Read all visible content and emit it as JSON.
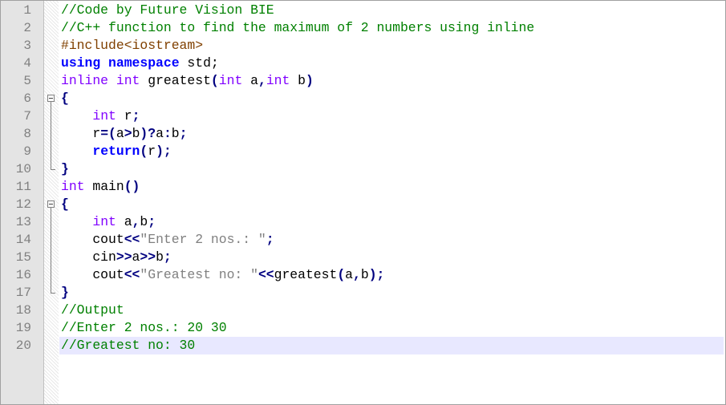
{
  "editor": {
    "current_line": 20,
    "lines": [
      {
        "n": "1",
        "tokens": [
          {
            "t": "//Code by Future Vision BIE",
            "c": "cm"
          }
        ]
      },
      {
        "n": "2",
        "tokens": [
          {
            "t": "//C++ function to find the maximum of 2 numbers using inline",
            "c": "cm"
          }
        ]
      },
      {
        "n": "3",
        "tokens": [
          {
            "t": "#include<iostream>",
            "c": "pp"
          }
        ]
      },
      {
        "n": "4",
        "tokens": [
          {
            "t": "using",
            "c": "kw"
          },
          {
            "t": " ",
            "c": "df"
          },
          {
            "t": "namespace",
            "c": "kw"
          },
          {
            "t": " std;",
            "c": "df"
          }
        ]
      },
      {
        "n": "5",
        "tokens": [
          {
            "t": "inline",
            "c": "ty"
          },
          {
            "t": " ",
            "c": "df"
          },
          {
            "t": "int",
            "c": "ty"
          },
          {
            "t": " greatest",
            "c": "df"
          },
          {
            "t": "(",
            "c": "op"
          },
          {
            "t": "int",
            "c": "ty"
          },
          {
            "t": " a",
            "c": "df"
          },
          {
            "t": ",",
            "c": "op"
          },
          {
            "t": "int",
            "c": "ty"
          },
          {
            "t": " b",
            "c": "df"
          },
          {
            "t": ")",
            "c": "op"
          }
        ],
        "fold": "none"
      },
      {
        "n": "6",
        "tokens": [
          {
            "t": "{",
            "c": "op"
          }
        ],
        "fold": "start"
      },
      {
        "n": "7",
        "tokens": [
          {
            "t": "    ",
            "c": "df"
          },
          {
            "t": "int",
            "c": "ty"
          },
          {
            "t": " r",
            "c": "df"
          },
          {
            "t": ";",
            "c": "op"
          }
        ],
        "fold": "mid"
      },
      {
        "n": "8",
        "tokens": [
          {
            "t": "    r",
            "c": "df"
          },
          {
            "t": "=(",
            "c": "op"
          },
          {
            "t": "a",
            "c": "df"
          },
          {
            "t": ">",
            "c": "op"
          },
          {
            "t": "b",
            "c": "df"
          },
          {
            "t": ")?",
            "c": "op"
          },
          {
            "t": "a",
            "c": "df"
          },
          {
            "t": ":",
            "c": "op"
          },
          {
            "t": "b",
            "c": "df"
          },
          {
            "t": ";",
            "c": "op"
          }
        ],
        "fold": "mid"
      },
      {
        "n": "9",
        "tokens": [
          {
            "t": "    ",
            "c": "df"
          },
          {
            "t": "return",
            "c": "kw"
          },
          {
            "t": "(",
            "c": "op"
          },
          {
            "t": "r",
            "c": "df"
          },
          {
            "t": ");",
            "c": "op"
          }
        ],
        "fold": "mid"
      },
      {
        "n": "10",
        "tokens": [
          {
            "t": "}",
            "c": "op"
          }
        ],
        "fold": "end"
      },
      {
        "n": "11",
        "tokens": [
          {
            "t": "int",
            "c": "ty"
          },
          {
            "t": " main",
            "c": "df"
          },
          {
            "t": "()",
            "c": "op"
          }
        ]
      },
      {
        "n": "12",
        "tokens": [
          {
            "t": "{",
            "c": "op"
          }
        ],
        "fold": "start"
      },
      {
        "n": "13",
        "tokens": [
          {
            "t": "    ",
            "c": "df"
          },
          {
            "t": "int",
            "c": "ty"
          },
          {
            "t": " a",
            "c": "df"
          },
          {
            "t": ",",
            "c": "op"
          },
          {
            "t": "b",
            "c": "df"
          },
          {
            "t": ";",
            "c": "op"
          }
        ],
        "fold": "mid"
      },
      {
        "n": "14",
        "tokens": [
          {
            "t": "    cout",
            "c": "df"
          },
          {
            "t": "<<",
            "c": "op"
          },
          {
            "t": "\"Enter 2 nos.: \"",
            "c": "st"
          },
          {
            "t": ";",
            "c": "op"
          }
        ],
        "fold": "mid"
      },
      {
        "n": "15",
        "tokens": [
          {
            "t": "    cin",
            "c": "df"
          },
          {
            "t": ">>",
            "c": "op"
          },
          {
            "t": "a",
            "c": "df"
          },
          {
            "t": ">>",
            "c": "op"
          },
          {
            "t": "b",
            "c": "df"
          },
          {
            "t": ";",
            "c": "op"
          }
        ],
        "fold": "mid"
      },
      {
        "n": "16",
        "tokens": [
          {
            "t": "    cout",
            "c": "df"
          },
          {
            "t": "<<",
            "c": "op"
          },
          {
            "t": "\"Greatest no: \"",
            "c": "st"
          },
          {
            "t": "<<",
            "c": "op"
          },
          {
            "t": "greatest",
            "c": "df"
          },
          {
            "t": "(",
            "c": "op"
          },
          {
            "t": "a",
            "c": "df"
          },
          {
            "t": ",",
            "c": "op"
          },
          {
            "t": "b",
            "c": "df"
          },
          {
            "t": ");",
            "c": "op"
          }
        ],
        "fold": "mid"
      },
      {
        "n": "17",
        "tokens": [
          {
            "t": "}",
            "c": "op"
          }
        ],
        "fold": "end"
      },
      {
        "n": "18",
        "tokens": [
          {
            "t": "//Output",
            "c": "cm"
          }
        ]
      },
      {
        "n": "19",
        "tokens": [
          {
            "t": "//Enter 2 nos.: 20 30",
            "c": "cm"
          }
        ]
      },
      {
        "n": "20",
        "tokens": [
          {
            "t": "//Greatest no: 30",
            "c": "cm"
          }
        ]
      }
    ]
  }
}
